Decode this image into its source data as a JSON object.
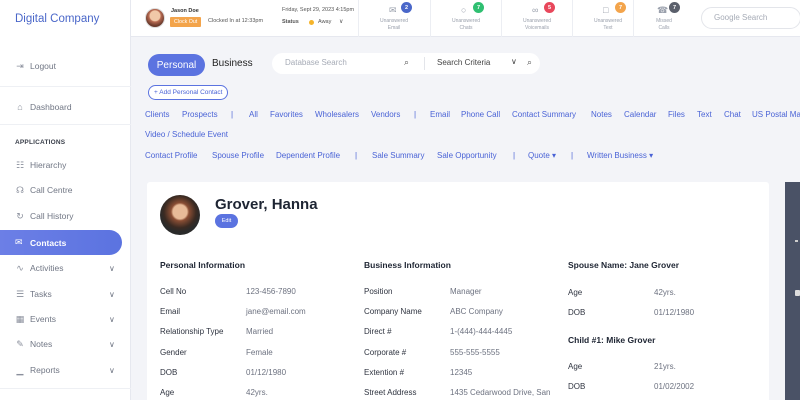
{
  "sidebar": {
    "brand": "Digital Company",
    "logout": "Logout",
    "dashboard": "Dashboard",
    "section": "APPLICATIONS",
    "items": [
      {
        "label": "Hierarchy",
        "icon": "hierarchy-icon"
      },
      {
        "label": "Call Centre",
        "icon": "headset-icon"
      },
      {
        "label": "Call History",
        "icon": "history-icon"
      },
      {
        "label": "Contacts",
        "icon": "mail-icon",
        "active": true
      },
      {
        "label": "Activities",
        "icon": "activity-icon"
      },
      {
        "label": "Tasks",
        "icon": "tasks-icon"
      },
      {
        "label": "Events",
        "icon": "calendar-icon"
      },
      {
        "label": "Notes",
        "icon": "pencil-icon"
      },
      {
        "label": "Reports",
        "icon": "bar-chart-icon"
      }
    ]
  },
  "topbar": {
    "user_name": "Jason Doe",
    "clock_button": "Clock Out",
    "clock_text": "Clocked In at 12:33pm",
    "date": "Friday, Sept 29, 2023 4:15pm",
    "status_label": "Status",
    "status_value": "Away",
    "status_color": "#f5b42a",
    "notifications": [
      {
        "label1": "Unanswered",
        "label2": "Email",
        "count": "2",
        "color": "#4a67c9",
        "icon": "mail-icon"
      },
      {
        "label1": "Unanswered",
        "label2": "Chats",
        "count": "7",
        "color": "#2fbf71",
        "icon": "chat-icon"
      },
      {
        "label1": "Unanswered",
        "label2": "Voicemails",
        "count": "5",
        "color": "#e8475b",
        "icon": "voicemail-icon"
      },
      {
        "label1": "Unanswered",
        "label2": "Text",
        "count": "7",
        "color": "#f3a44b",
        "icon": "text-message-icon"
      },
      {
        "label1": "Missed",
        "label2": "Calls",
        "count": "7",
        "color": "#5a5f6b",
        "icon": "phone-icon"
      }
    ],
    "search_placeholder": "Google Search"
  },
  "main": {
    "tab_personal": "Personal",
    "tab_business": "Business",
    "db_search_placeholder": "Database Search",
    "criteria": "Search Criteria",
    "add_contact": "+ Add Personal Contact",
    "nav_row1": [
      "Clients",
      "Prospects",
      "|",
      "All",
      "Favorites",
      "Wholesalers",
      "Vendors",
      "|",
      "Email",
      "Phone Call",
      "Contact Summary",
      "Notes",
      "Calendar",
      "Files",
      "Text",
      "Chat",
      "US Postal Mai"
    ],
    "nav_row2": [
      "Video / Schedule Event"
    ],
    "nav_row3": [
      "Contact Profile",
      "Spouse Profile",
      "Dependent Profile",
      "|",
      "Sale Summary",
      "Sale Opportunity",
      "|",
      "Quote ▾",
      "|",
      "Written Business ▾"
    ]
  },
  "contact": {
    "name": "Grover, Hanna",
    "edit": "Edit",
    "personal_title": "Personal Information",
    "personal": [
      {
        "label": "Cell No",
        "value": "123-456-7890"
      },
      {
        "label": "Email",
        "value": "jane@email.com"
      },
      {
        "label": "Relationship Type",
        "value": "Married"
      },
      {
        "label": "Gender",
        "value": "Female"
      },
      {
        "label": "DOB",
        "value": "01/12/1980"
      },
      {
        "label": "Age",
        "value": "42yrs."
      }
    ],
    "business_title": "Business Information",
    "business": [
      {
        "label": "Position",
        "value": "Manager"
      },
      {
        "label": "Company Name",
        "value": "ABC Company"
      },
      {
        "label": "Direct #",
        "value": "1-(444)-444-4445"
      },
      {
        "label": "Corporate #",
        "value": "555-555-5555"
      },
      {
        "label": "Extention #",
        "value": "12345"
      },
      {
        "label": "Street Address",
        "value": "1435 Cedarwood Drive, San"
      }
    ],
    "spouse_title": "Spouse Name: Jane Grover",
    "spouse": [
      {
        "label": "Age",
        "value": "42yrs."
      },
      {
        "label": "DOB",
        "value": "01/12/1980"
      }
    ],
    "child_title": "Child #1: Mike Grover",
    "child": [
      {
        "label": "Age",
        "value": "21yrs."
      },
      {
        "label": "DOB",
        "value": "01/02/2002"
      }
    ]
  }
}
